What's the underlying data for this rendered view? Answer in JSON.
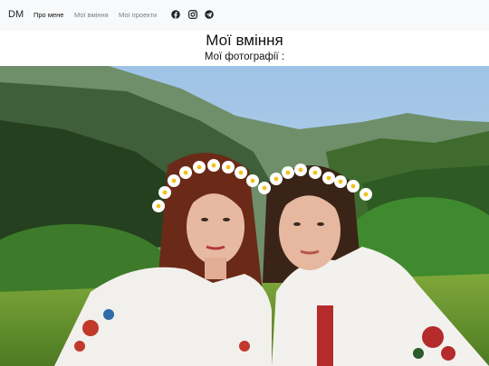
{
  "navbar": {
    "brand": "DM",
    "links": [
      {
        "label": "Про мене",
        "active": true
      },
      {
        "label": "Мої вміння",
        "active": false
      },
      {
        "label": "Мої проекти",
        "active": false
      }
    ],
    "social_icons": [
      "facebook-icon",
      "instagram-icon",
      "telegram-icon"
    ]
  },
  "main": {
    "title": "Мої вміння",
    "subtitle": "Мої фотографії :"
  },
  "colors": {
    "navbar_bg": "#f8f9fa",
    "text": "#212529",
    "muted_link": "#7a7d80"
  }
}
